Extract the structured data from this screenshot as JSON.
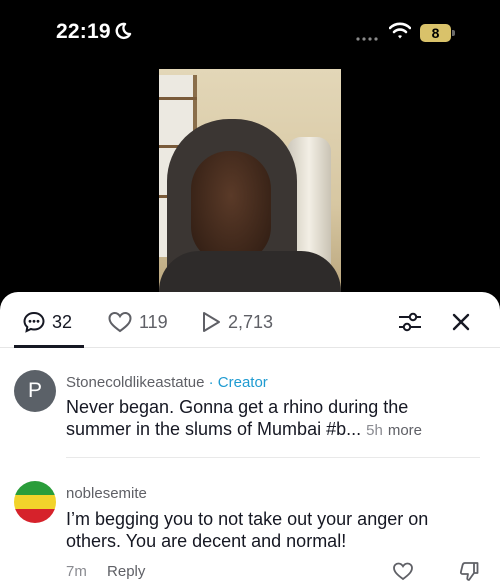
{
  "status_bar": {
    "time": "22:19",
    "battery": "8",
    "icons": [
      "moon-icon",
      "signal-dots-icon",
      "wifi-icon",
      "battery-icon"
    ]
  },
  "video": {
    "description_icon": "video-thumbnail"
  },
  "tabs": {
    "comments_count": "32",
    "likes_count": "119",
    "views_count": "2,713"
  },
  "comments": [
    {
      "avatar_letter": "P",
      "username": "Stonecoldlikeastatue",
      "separator": " · ",
      "badge": "Creator",
      "text": "Never began. Gonna get a rhino during the summer in the slums of Mumbai #b...",
      "time": "5h",
      "more_label": "more"
    },
    {
      "username": "noblesemite",
      "text": "I’m begging you to not take out your anger on others. You are decent and normal!",
      "time": "7m",
      "reply_label": "Reply"
    }
  ],
  "colors": {
    "creator_badge": "#1f9bd1",
    "battery": "#d9c26a"
  }
}
